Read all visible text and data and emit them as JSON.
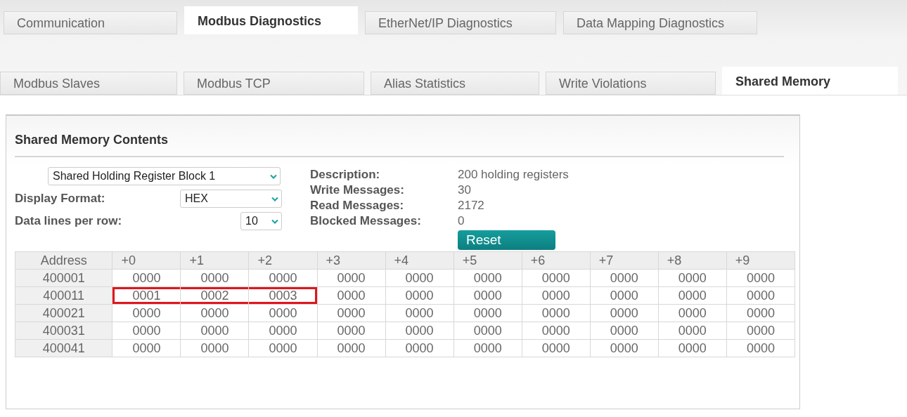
{
  "main_tabs": [
    {
      "label": "Communication",
      "selected": false
    },
    {
      "label": "Modbus Diagnostics",
      "selected": true
    },
    {
      "label": "EtherNet/IP Diagnostics",
      "selected": false
    },
    {
      "label": "Data Mapping Diagnostics",
      "selected": false
    }
  ],
  "sub_tabs": [
    {
      "label": "Modbus Slaves",
      "selected": false
    },
    {
      "label": "Modbus TCP",
      "selected": false
    },
    {
      "label": "Alias Statistics",
      "selected": false
    },
    {
      "label": "Write Violations",
      "selected": false
    },
    {
      "label": "Shared Memory",
      "selected": true
    }
  ],
  "panel": {
    "title": "Shared Memory Contents",
    "block_select": {
      "value": "Shared Holding Register Block 1"
    },
    "display_format": {
      "label": "Display Format:",
      "value": "HEX"
    },
    "data_lines": {
      "label": "Data lines per row:",
      "value": "10"
    },
    "info": [
      {
        "label": "Description:",
        "value": "200 holding registers"
      },
      {
        "label": "Write Messages:",
        "value": "30"
      },
      {
        "label": "Read Messages:",
        "value": "2172"
      },
      {
        "label": "Blocked Messages:",
        "value": "0"
      }
    ],
    "reset_button": "Reset",
    "table": {
      "address_column": "Address",
      "columns": [
        "+0",
        "+1",
        "+2",
        "+3",
        "+4",
        "+5",
        "+6",
        "+7",
        "+8",
        "+9"
      ],
      "rows": [
        {
          "address": "400001",
          "cells": [
            "0000",
            "0000",
            "0000",
            "0000",
            "0000",
            "0000",
            "0000",
            "0000",
            "0000",
            "0000"
          ],
          "marked": [
            false,
            false,
            false,
            false,
            false,
            false,
            false,
            false,
            false,
            false
          ]
        },
        {
          "address": "400011",
          "cells": [
            "0001",
            "0002",
            "0003",
            "0000",
            "0000",
            "0000",
            "0000",
            "0000",
            "0000",
            "0000"
          ],
          "marked": [
            true,
            true,
            true,
            false,
            false,
            false,
            false,
            false,
            false,
            false
          ]
        },
        {
          "address": "400021",
          "cells": [
            "0000",
            "0000",
            "0000",
            "0000",
            "0000",
            "0000",
            "0000",
            "0000",
            "0000",
            "0000"
          ],
          "marked": [
            false,
            false,
            false,
            false,
            false,
            false,
            false,
            false,
            false,
            false
          ]
        },
        {
          "address": "400031",
          "cells": [
            "0000",
            "0000",
            "0000",
            "0000",
            "0000",
            "0000",
            "0000",
            "0000",
            "0000",
            "0000"
          ],
          "marked": [
            false,
            false,
            false,
            false,
            false,
            false,
            false,
            false,
            false,
            false
          ]
        },
        {
          "address": "400041",
          "cells": [
            "0000",
            "0000",
            "0000",
            "0000",
            "0000",
            "0000",
            "0000",
            "0000",
            "0000",
            "0000"
          ],
          "marked": [
            false,
            false,
            false,
            false,
            false,
            false,
            false,
            false,
            false,
            false
          ]
        }
      ]
    }
  }
}
